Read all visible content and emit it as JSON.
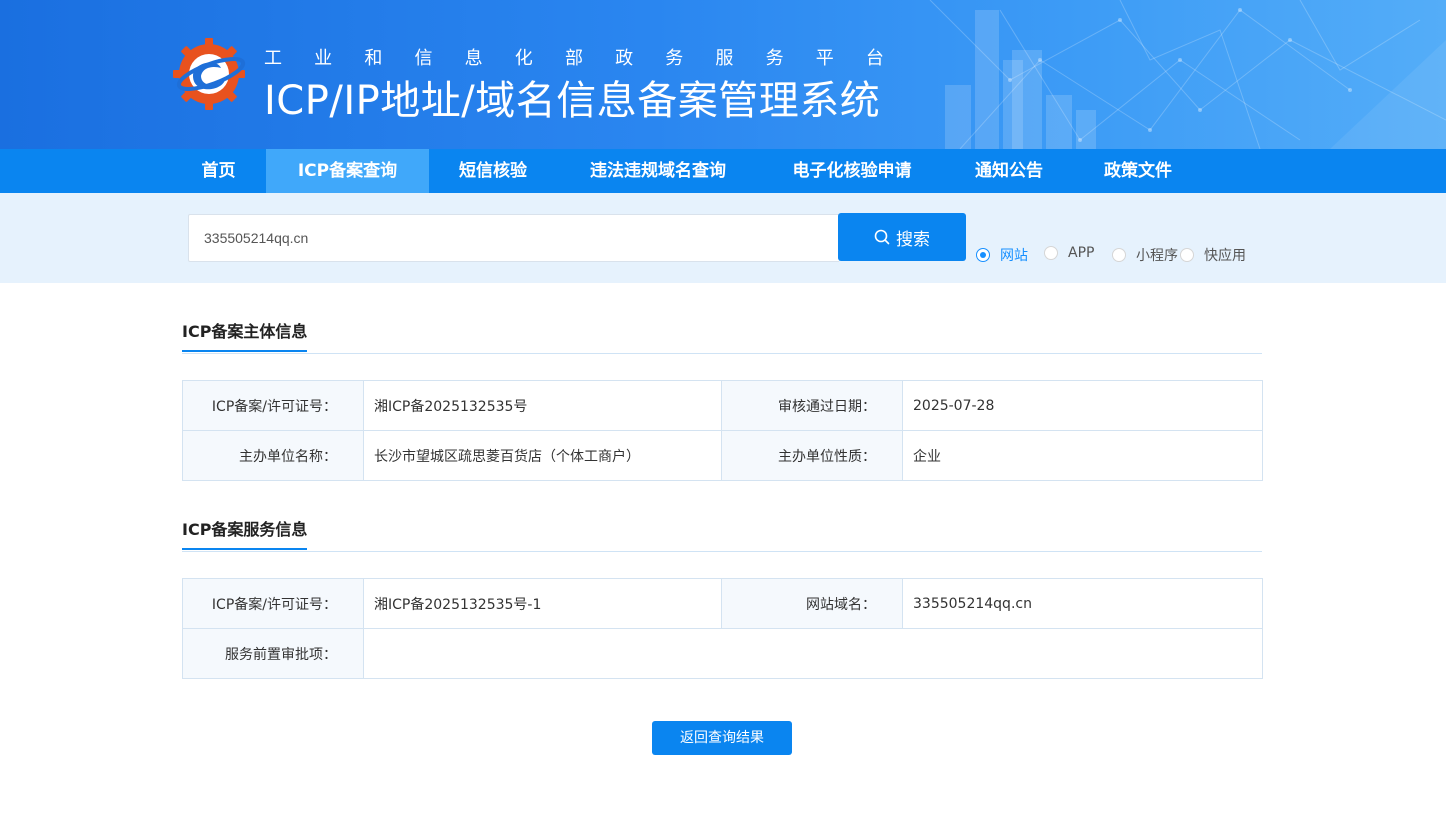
{
  "header": {
    "subtitle_chars": [
      "工",
      "业",
      "和",
      "信",
      "息",
      "化",
      "部",
      "政",
      "务",
      "服",
      "务",
      "平",
      "台"
    ],
    "title": "ICP/IP地址/域名信息备案管理系统"
  },
  "nav": {
    "items": [
      {
        "label": "首页"
      },
      {
        "label": "ICP备案查询"
      },
      {
        "label": "短信核验"
      },
      {
        "label": "违法违规域名查询"
      },
      {
        "label": "电子化核验申请"
      },
      {
        "label": "通知公告"
      },
      {
        "label": "政策文件"
      }
    ],
    "active_index": 1
  },
  "search": {
    "value": "335505214qq.cn",
    "button_label": "搜索",
    "types": [
      {
        "label": "网站",
        "checked": true
      },
      {
        "label": "APP",
        "checked": false
      },
      {
        "label": "小程序",
        "checked": false
      },
      {
        "label": "快应用",
        "checked": false
      }
    ]
  },
  "entity": {
    "title": "ICP备案主体信息",
    "license_label": "ICP备案/许可证号：",
    "license_value": "湘ICP备2025132535号",
    "date_label": "审核通过日期：",
    "date_value": "2025-07-28",
    "org_name_label": "主办单位名称：",
    "org_name_value": "长沙市望城区疏思菱百货店（个体工商户）",
    "org_type_label": "主办单位性质：",
    "org_type_value": "企业"
  },
  "service": {
    "title": "ICP备案服务信息",
    "license_label": "ICP备案/许可证号：",
    "license_value": "湘ICP备2025132535号-1",
    "domain_label": "网站域名：",
    "domain_value": "335505214qq.cn",
    "approval_label": "服务前置审批项：",
    "approval_value": ""
  },
  "back_button_label": "返回查询结果",
  "colors": {
    "primary": "#0a85f0",
    "nav_active": "#40a8fa",
    "search_band": "#e6f2fd",
    "radio_checked": "#1890ff"
  }
}
